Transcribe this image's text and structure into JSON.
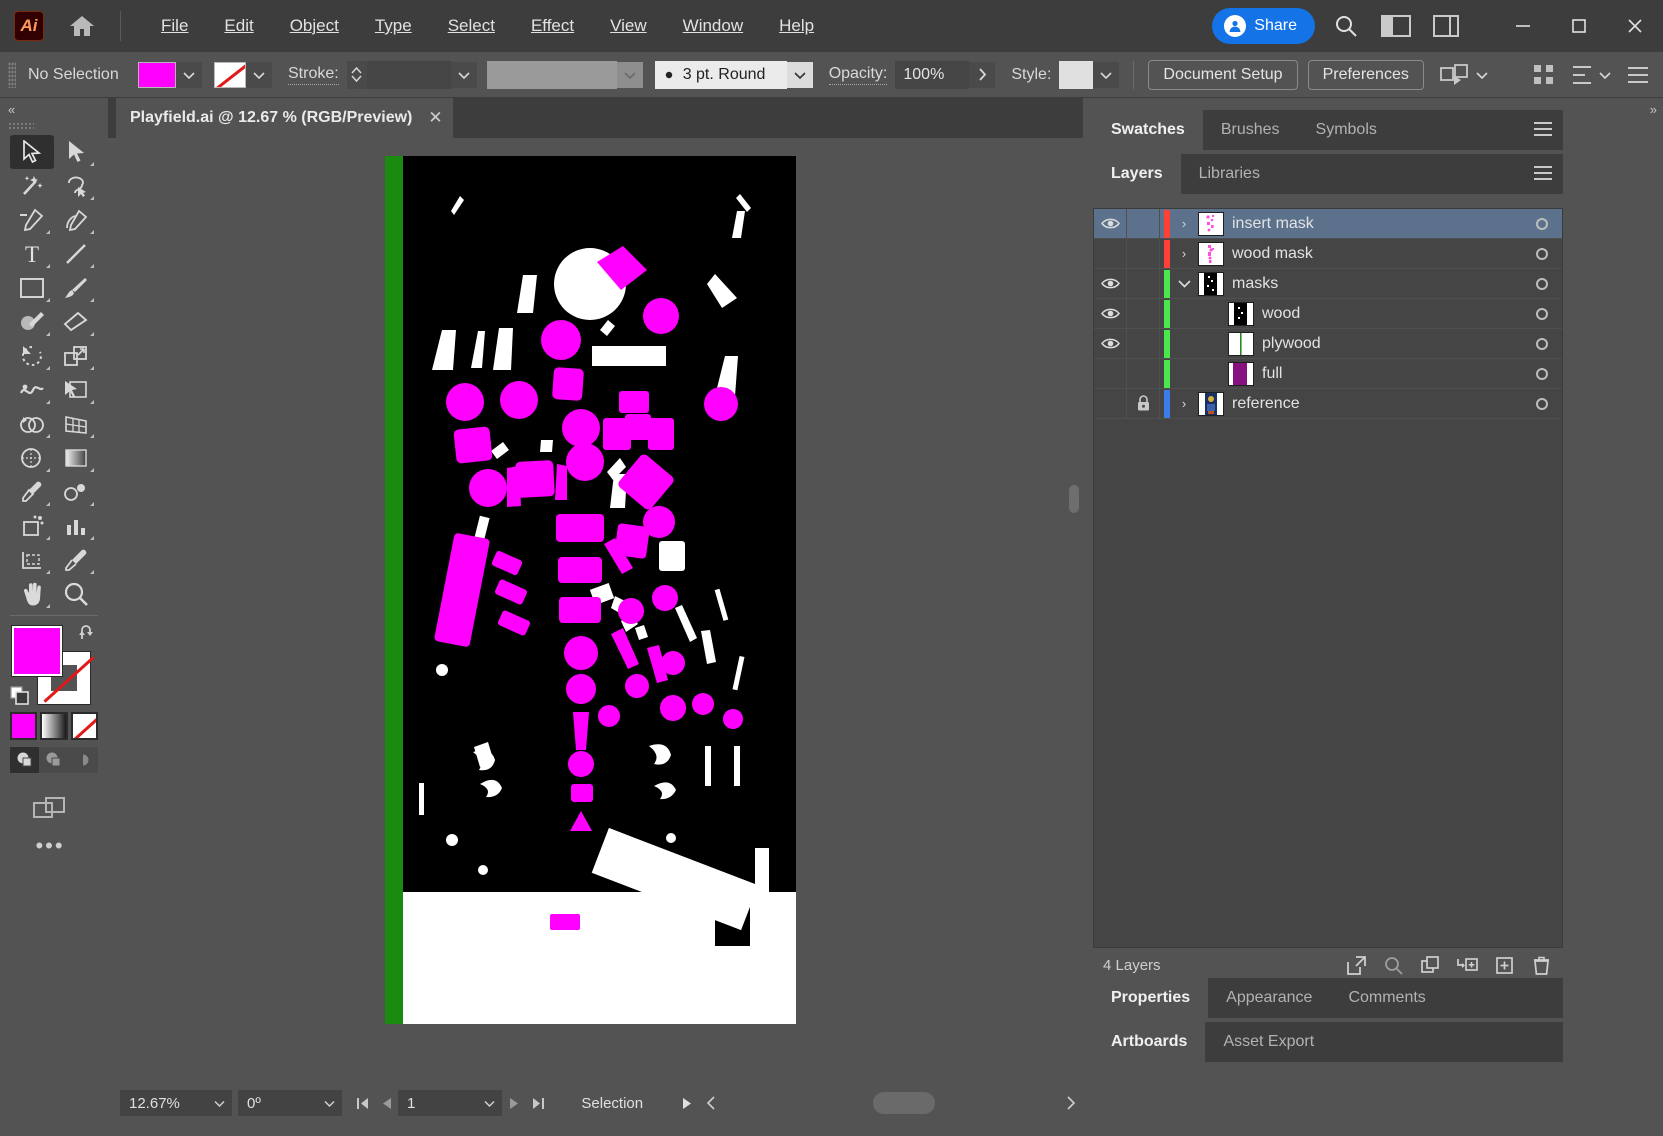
{
  "app": {
    "name": "Adobe Illustrator",
    "logo_text": "Ai",
    "home_icon": "home-icon"
  },
  "menubar": {
    "items": [
      {
        "label": "File",
        "accel": "F"
      },
      {
        "label": "Edit",
        "accel": "E"
      },
      {
        "label": "Object",
        "accel": "O"
      },
      {
        "label": "Type",
        "accel": "T"
      },
      {
        "label": "Select",
        "accel": "S"
      },
      {
        "label": "Effect",
        "accel": "c"
      },
      {
        "label": "View",
        "accel": "V"
      },
      {
        "label": "Window",
        "accel": "W"
      },
      {
        "label": "Help",
        "accel": "H"
      }
    ],
    "share_label": "Share",
    "share_badge": "⬤",
    "search_icon": "search-icon",
    "arrange_icon": "arrange-documents-icon",
    "workspace_icon": "workspace-switcher-icon",
    "window_minimize": "—",
    "window_maximize": "□",
    "window_close": "✕"
  },
  "controlbar": {
    "selection_status": "No Selection",
    "fill_color": "#ff00ff",
    "stroke_color": "none",
    "stroke_label": "Stroke:",
    "stroke_weight": "",
    "stroke_profile": "",
    "brush_definition": "3 pt. Round",
    "opacity_label": "Opacity:",
    "opacity_value": "100%",
    "style_label": "Style:",
    "style_swatch": "#e8e8e8",
    "document_setup_label": "Document Setup",
    "preferences_label": "Preferences",
    "align_icon": "align-objects-icon",
    "transform_icon": "transform-icon",
    "options_icon": "panel-options-icon"
  },
  "toolbar": {
    "tools": [
      {
        "name": "selection-tool",
        "glyph": "selection",
        "active": true
      },
      {
        "name": "direct-selection-tool",
        "glyph": "direct-selection",
        "active": false
      },
      {
        "name": "magic-wand-tool",
        "glyph": "magic-wand",
        "active": false
      },
      {
        "name": "lasso-tool",
        "glyph": "lasso",
        "active": false
      },
      {
        "name": "pen-tool",
        "glyph": "pen",
        "active": false
      },
      {
        "name": "curvature-tool",
        "glyph": "curvature",
        "active": false
      },
      {
        "name": "type-tool",
        "glyph": "type",
        "active": false
      },
      {
        "name": "line-segment-tool",
        "glyph": "line",
        "active": false
      },
      {
        "name": "rectangle-tool",
        "glyph": "rectangle",
        "active": false
      },
      {
        "name": "paintbrush-tool",
        "glyph": "paintbrush",
        "active": false
      },
      {
        "name": "shaper-tool",
        "glyph": "shaper",
        "active": false
      },
      {
        "name": "eraser-tool",
        "glyph": "eraser",
        "active": false
      },
      {
        "name": "rotate-tool",
        "glyph": "rotate",
        "active": false
      },
      {
        "name": "scale-tool",
        "glyph": "scale",
        "active": false
      },
      {
        "name": "width-tool",
        "glyph": "width",
        "active": false
      },
      {
        "name": "free-transform-tool",
        "glyph": "free-transform",
        "active": false
      },
      {
        "name": "shape-builder-tool",
        "glyph": "shape-builder",
        "active": false
      },
      {
        "name": "perspective-grid-tool",
        "glyph": "perspective-grid",
        "active": false
      },
      {
        "name": "mesh-tool",
        "glyph": "mesh",
        "active": false
      },
      {
        "name": "gradient-tool",
        "glyph": "gradient",
        "active": false
      },
      {
        "name": "eyedropper-tool",
        "glyph": "eyedropper",
        "active": false
      },
      {
        "name": "blend-tool",
        "glyph": "blend",
        "active": false
      },
      {
        "name": "symbol-sprayer-tool",
        "glyph": "symbol-sprayer",
        "active": false
      },
      {
        "name": "column-graph-tool",
        "glyph": "column-graph",
        "active": false
      },
      {
        "name": "artboard-tool",
        "glyph": "artboard",
        "active": false
      },
      {
        "name": "slice-tool",
        "glyph": "slice",
        "active": false
      },
      {
        "name": "hand-tool",
        "glyph": "hand",
        "active": false
      },
      {
        "name": "zoom-tool",
        "glyph": "zoom",
        "active": false
      }
    ],
    "fill_color": "#ff00ff",
    "stroke_color": "#ffffff",
    "stroke_is_none": true,
    "swap_icon": "swap-fill-stroke-icon",
    "default_icon": "default-fill-stroke-icon",
    "color_mode_icon": "color-mode-icon",
    "gradient_mode_icon": "gradient-mode-icon",
    "none_mode_icon": "none-mode-icon",
    "draw_normal_icon": "draw-normal-icon",
    "draw_behind_icon": "draw-behind-icon",
    "draw_inside_icon": "draw-inside-icon",
    "screen_mode_icon": "change-screen-mode-icon",
    "more_tools_icon": "edit-toolbar-icon",
    "more_tools_glyph": "•••"
  },
  "document": {
    "tab_title": "Playfield.ai @ 12.67 % (RGB/Preview)",
    "close_glyph": "✕",
    "artboard": {
      "background": "#000000",
      "left_strip_color": "#1a8a10",
      "magenta": "#ff00ff",
      "white": "#ffffff"
    }
  },
  "statusbar": {
    "zoom_value": "12.67%",
    "rotation_value": "0º",
    "artboard_number": "1",
    "status_text": "Selection",
    "first_icon": "first-artboard-icon",
    "prev_icon": "previous-artboard-icon",
    "next_icon": "next-artboard-icon",
    "last_icon": "last-artboard-icon",
    "play_icon": "status-menu-icon",
    "back_icon": "scroll-left-icon"
  },
  "panels": {
    "top_group": {
      "tabs": [
        {
          "label": "Swatches",
          "active": true
        },
        {
          "label": "Brushes",
          "active": false
        },
        {
          "label": "Symbols",
          "active": false
        }
      ],
      "menu_icon": "panel-menu-icon"
    },
    "layers_group": {
      "tabs": [
        {
          "label": "Layers",
          "active": true
        },
        {
          "label": "Libraries",
          "active": false
        }
      ],
      "menu_icon": "panel-menu-icon"
    },
    "layers": [
      {
        "name": "insert mask",
        "visible": true,
        "locked": false,
        "color": "#ff4036",
        "expandable": true,
        "expanded": false,
        "indent": 0,
        "selected": true,
        "thumb": "art-magenta"
      },
      {
        "name": "wood mask",
        "visible": false,
        "locked": false,
        "color": "#ff4036",
        "expandable": true,
        "expanded": false,
        "indent": 0,
        "selected": false,
        "thumb": "art-magenta"
      },
      {
        "name": "masks",
        "visible": true,
        "locked": false,
        "color": "#4ae84a",
        "expandable": true,
        "expanded": true,
        "indent": 0,
        "selected": false,
        "thumb": "art-blackwhite"
      },
      {
        "name": "wood",
        "visible": true,
        "locked": false,
        "color": "#4ae84a",
        "expandable": false,
        "expanded": false,
        "indent": 1,
        "selected": false,
        "thumb": "art-blackwhite"
      },
      {
        "name": "plywood",
        "visible": true,
        "locked": false,
        "color": "#4ae84a",
        "expandable": false,
        "expanded": false,
        "indent": 1,
        "selected": false,
        "thumb": "art-whitegreen"
      },
      {
        "name": "full",
        "visible": false,
        "locked": false,
        "color": "#4ae84a",
        "expandable": false,
        "expanded": false,
        "indent": 1,
        "selected": false,
        "thumb": "art-purple"
      },
      {
        "name": "reference",
        "visible": false,
        "locked": true,
        "color": "#3a7ce8",
        "expandable": true,
        "expanded": false,
        "indent": 0,
        "selected": false,
        "thumb": "art-photo"
      }
    ],
    "layers_footer": {
      "count_text": "4 Layers",
      "icons": [
        {
          "name": "release-to-layers-icon"
        },
        {
          "name": "locate-object-icon"
        },
        {
          "name": "create-sublayer-icon"
        },
        {
          "name": "create-new-layer-icon"
        },
        {
          "name": "add-layer-icon"
        },
        {
          "name": "delete-selection-icon"
        }
      ]
    },
    "properties_group": {
      "tabs": [
        {
          "label": "Properties",
          "active": true
        },
        {
          "label": "Appearance",
          "active": false
        },
        {
          "label": "Comments",
          "active": false
        }
      ]
    },
    "artboards_group": {
      "tabs": [
        {
          "label": "Artboards",
          "active": true
        },
        {
          "label": "Asset Export",
          "active": false
        }
      ]
    }
  },
  "colors": {
    "magenta": "#ff00ff",
    "accent_blue": "#1473e6",
    "panel_bg": "#535353",
    "panel_dark": "#3d3d3d",
    "list_bg": "#454545",
    "selection_blue": "#5b718c"
  }
}
